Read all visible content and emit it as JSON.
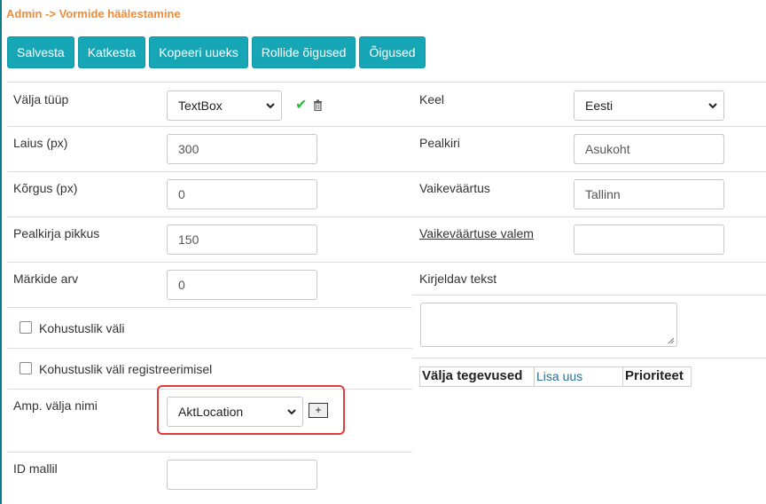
{
  "breadcrumb": "Admin -> Vormide häälestamine",
  "toolbar": {
    "save": "Salvesta",
    "cancel": "Katkesta",
    "copy_new": "Kopeeri uueks",
    "role_rights": "Rollide õigused",
    "rights": "Õigused"
  },
  "left": {
    "field_type_label": "Välja tüüp",
    "field_type_value": "TextBox",
    "width_label": "Laius (px)",
    "width_value": "300",
    "height_label": "Kõrgus (px)",
    "height_value": "0",
    "caption_length_label": "Pealkirja pikkus",
    "caption_length_value": "150",
    "char_count_label": "Märkide arv",
    "char_count_value": "0",
    "required_label": "Kohustuslik väli",
    "required_registration_label": "Kohustuslik väli registreerimisel",
    "amp_field_name_label": "Amp. välja nimi",
    "amp_field_name_value": "AktLocation",
    "amp_add_label": "+",
    "template_id_label": "ID mallil",
    "template_id_value": ""
  },
  "right": {
    "language_label": "Keel",
    "language_value": "Eesti",
    "caption_label": "Pealkiri",
    "caption_value": "Asukoht",
    "default_label": "Vaikeväärtus",
    "default_value": "Tallinn",
    "default_formula_label": "Vaikeväärtuse valem",
    "default_formula_value": "",
    "description_label": "Kirjeldav tekst"
  },
  "actions_table": {
    "col_actions": "Välja tegevused",
    "add_new": "Lisa uus",
    "col_priority": "Prioriteet"
  },
  "icons": {
    "confirm": "check-icon",
    "delete": "trash-icon",
    "dropdown": "chevron-down-icon"
  },
  "colors": {
    "accent": "#17a6b6",
    "breadcrumb": "#f08b3a",
    "confirm": "#26c036",
    "highlight": "#e23b3b"
  }
}
